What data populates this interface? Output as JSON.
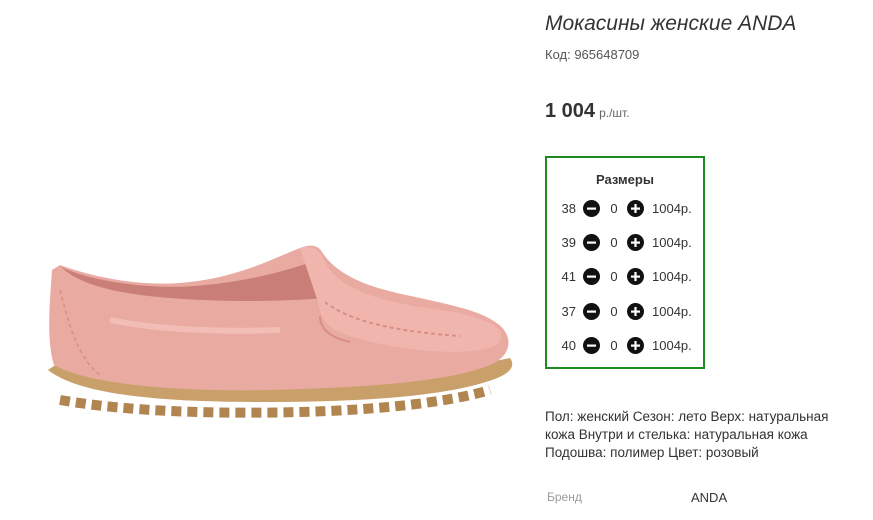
{
  "product": {
    "title": "Мокасины женские ANDA",
    "code": "Код: 965648709",
    "price": "1 004",
    "price_unit": "р./шт.",
    "image": {
      "subject": "pink leather women's moccasin",
      "color": "#e8a79f"
    }
  },
  "sizes": {
    "title": "Размеры",
    "rows": [
      {
        "size": "38",
        "qty": "0",
        "price": "1004р."
      },
      {
        "size": "39",
        "qty": "0",
        "price": "1004р."
      },
      {
        "size": "41",
        "qty": "0",
        "price": "1004р."
      },
      {
        "size": "37",
        "qty": "0",
        "price": "1004р."
      },
      {
        "size": "40",
        "qty": "0",
        "price": "1004р."
      }
    ],
    "border_color": "#1f8a1f"
  },
  "description": "Пол: женский Сезон: лето Верх: натуральная кожа Внутри и стелька: натуральная кожа Подошва: полимер Цвет: розовый",
  "brand": {
    "label": "Бренд",
    "value": "ANDA"
  },
  "icons": {
    "minus": "minus-circle-icon",
    "plus": "plus-circle-icon"
  }
}
